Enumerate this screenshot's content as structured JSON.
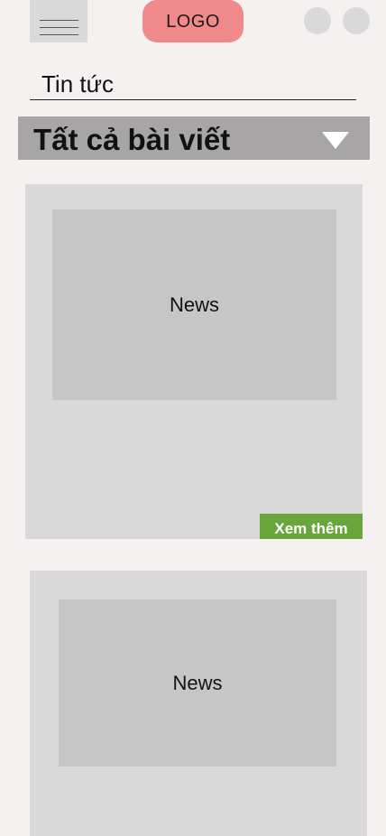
{
  "header": {
    "logo_text": "LOGO"
  },
  "page": {
    "title": "Tin tức"
  },
  "filter": {
    "selected": "Tất cả bài viết"
  },
  "articles": [
    {
      "thumbnail_label": "News",
      "more_label": "Xem thêm"
    },
    {
      "thumbnail_label": "News"
    }
  ],
  "colors": {
    "background": "#f6f1f1",
    "logo": "#f08a8a",
    "placeholder": "#d9d9d9",
    "thumbnail": "#c6c6c6",
    "filter_bar": "#a7a5a5",
    "accent": "#6aa53b"
  },
  "icons": {
    "menu": "hamburger-icon",
    "dropdown": "triangle-down-icon"
  }
}
